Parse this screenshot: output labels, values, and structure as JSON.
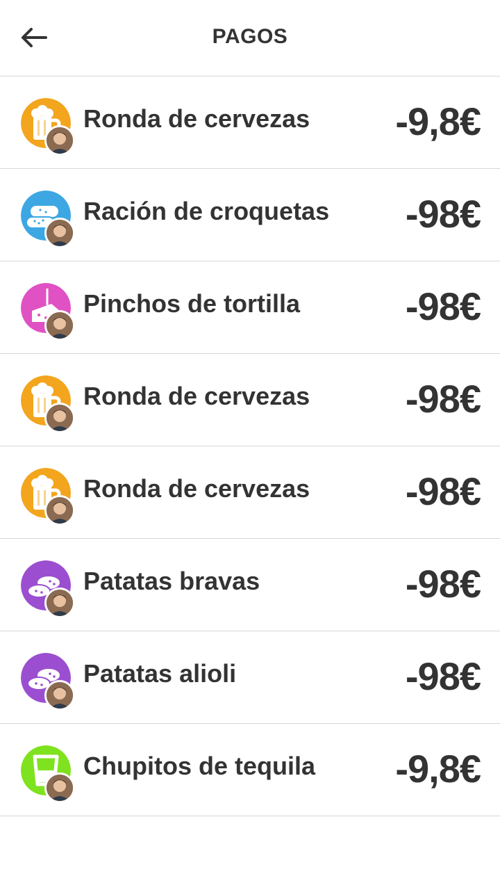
{
  "header": {
    "title": "PAGOS",
    "back_icon": "arrow-left-icon"
  },
  "payments": [
    {
      "label": "Ronda de cervezas",
      "amount": "-9,8€",
      "category_icon": "beer-icon",
      "color": "#f2a51d"
    },
    {
      "label": "Ración de croquetas",
      "amount": "-98€",
      "category_icon": "croquettes-icon",
      "color": "#3ca7e3"
    },
    {
      "label": "Pinchos de tortilla",
      "amount": "-98€",
      "category_icon": "tortilla-icon",
      "color": "#e051c4"
    },
    {
      "label": "Ronda de cervezas",
      "amount": "-98€",
      "category_icon": "beer-icon",
      "color": "#f2a51d"
    },
    {
      "label": "Ronda de cervezas",
      "amount": "-98€",
      "category_icon": "beer-icon",
      "color": "#f2a51d"
    },
    {
      "label": "Patatas bravas",
      "amount": "-98€",
      "category_icon": "potatoes-icon",
      "color": "#9b4fd0"
    },
    {
      "label": "Patatas alioli",
      "amount": "-98€",
      "category_icon": "potatoes-icon",
      "color": "#9b4fd0"
    },
    {
      "label": "Chupitos de tequila",
      "amount": "-9,8€",
      "category_icon": "shot-glass-icon",
      "color": "#7fe21f"
    }
  ]
}
